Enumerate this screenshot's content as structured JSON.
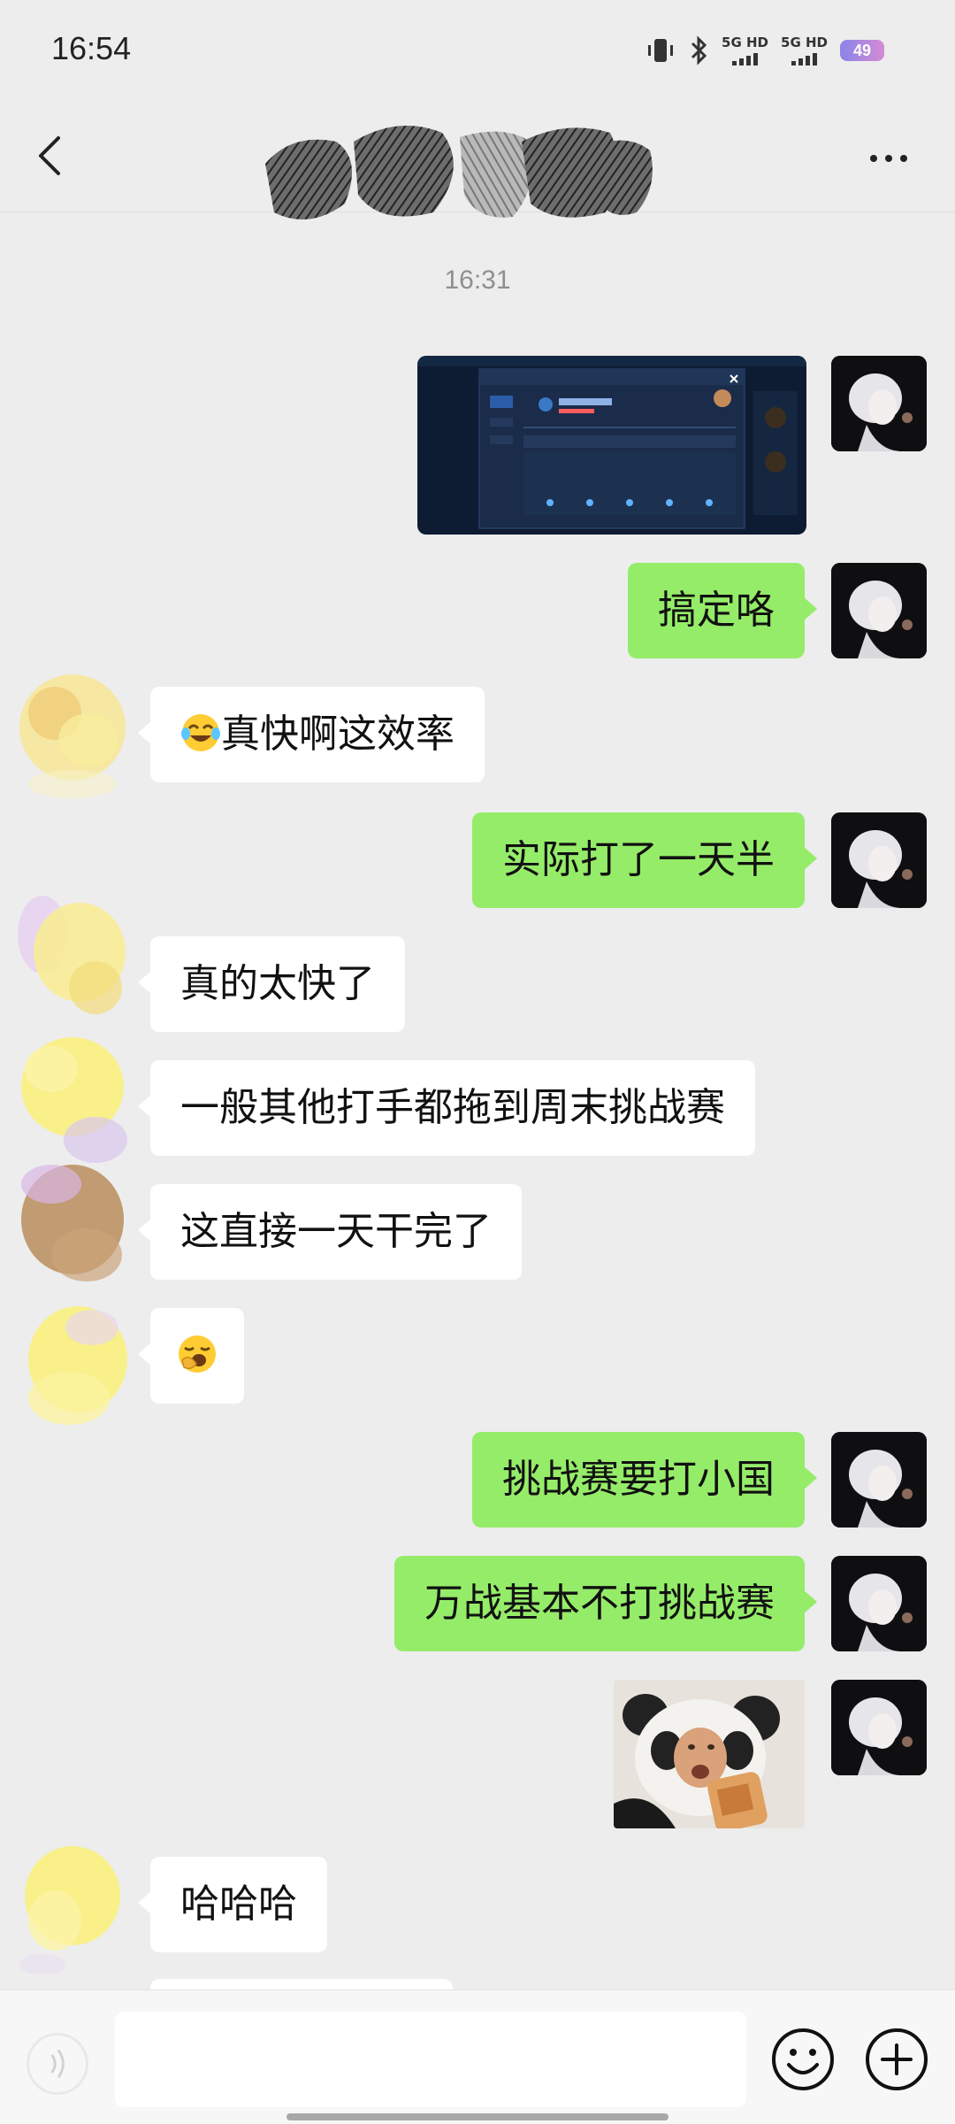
{
  "status_bar": {
    "time": "16:54",
    "net1": "5G HD",
    "net2": "5G HD",
    "battery": "49"
  },
  "nav": {
    "back_icon": "chevron-left-icon",
    "more_icon": "more-icon"
  },
  "timestamp": "16:31",
  "messages": [
    {
      "side": "me",
      "type": "image",
      "content": "game-screenshot"
    },
    {
      "side": "me",
      "type": "text",
      "text": "搞定咯"
    },
    {
      "side": "other",
      "type": "text",
      "emoji": "joy",
      "text": "真快啊这效率"
    },
    {
      "side": "me",
      "type": "text",
      "text": "实际打了一天半"
    },
    {
      "side": "other",
      "type": "text",
      "text": "真的太快了"
    },
    {
      "side": "other",
      "type": "text",
      "text": "一般其他打手都拖到周末挑战赛"
    },
    {
      "side": "other",
      "type": "text",
      "text": "这直接一天干完了"
    },
    {
      "side": "other",
      "type": "emoji",
      "emoji": "yawning-face"
    },
    {
      "side": "me",
      "type": "text",
      "text": "挑战赛要打小国"
    },
    {
      "side": "me",
      "type": "text",
      "text": "万战基本不打挑战赛"
    },
    {
      "side": "me",
      "type": "image",
      "content": "panda-meme-sticker"
    },
    {
      "side": "other",
      "type": "text",
      "text": "哈哈哈"
    }
  ],
  "input_bar": {
    "placeholder": "",
    "voice_icon": "voice-icon",
    "emoji_icon": "smile-icon",
    "plus_icon": "plus-icon"
  },
  "colors": {
    "background": "#ededed",
    "bubble_me": "#95ec69",
    "bubble_other": "#ffffff"
  }
}
